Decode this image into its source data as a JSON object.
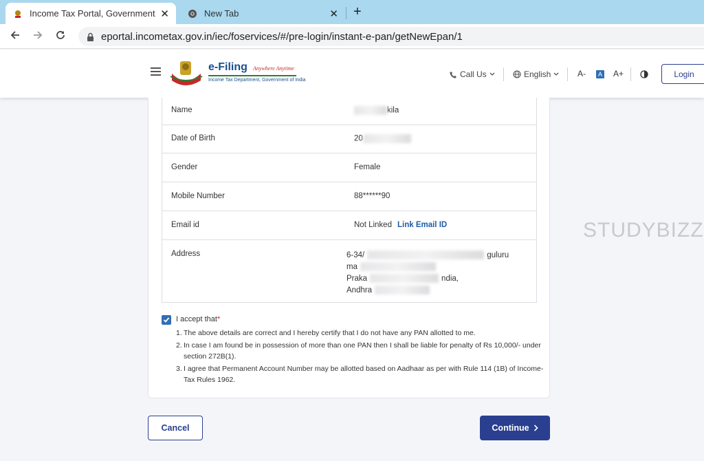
{
  "browser": {
    "tabs": [
      {
        "title": "Income Tax Portal, Government of India",
        "active": true
      },
      {
        "title": "New Tab",
        "active": false
      }
    ],
    "url": "eportal.incometax.gov.in/iec/foservices/#/pre-login/instant-e-pan/getNewEpan/1"
  },
  "header": {
    "logo_title": "e-Filing",
    "logo_tagline": "Anywhere Anytime",
    "logo_subtitle": "Income Tax Department, Government of India",
    "call_us": "Call Us",
    "language": "English",
    "font_decrease": "A-",
    "font_normal": "A",
    "font_increase": "A+",
    "login": "Login"
  },
  "details": {
    "rows": [
      {
        "label": "Name",
        "value": "kila"
      },
      {
        "label": "Date of Birth",
        "value": "20"
      },
      {
        "label": "Gender",
        "value": "Female"
      },
      {
        "label": "Mobile Number",
        "value": "88******90"
      },
      {
        "label": "Email id",
        "value": "Not Linked",
        "link": "Link Email ID"
      },
      {
        "label": "Address",
        "lines": [
          "6-34/",
          "ma",
          "Praka",
          "Andhra"
        ],
        "line_suffixes": [
          "guluru",
          "",
          "ndia,",
          ""
        ]
      }
    ]
  },
  "accept": {
    "label": "I accept that",
    "required_mark": "*",
    "checked": true,
    "terms": [
      "The above details are correct and I hereby certify that I do not have any PAN allotted to me.",
      "In case I am found be in possession of more than one PAN then I shall be liable for penalty of Rs 10,000/- under section 272B(1).",
      "I agree that Permanent Account Number may be allotted based on Aadhaar as per with Rule 114 (1B) of Income-Tax Rules 1962."
    ]
  },
  "actions": {
    "cancel": "Cancel",
    "continue": "Continue"
  },
  "watermark": "STUDYBIZZ",
  "colors": {
    "primary": "#2a3f8f",
    "link": "#1f5ca8",
    "tabbar": "#a9d8ef",
    "page_bg": "#f4f5f9"
  }
}
